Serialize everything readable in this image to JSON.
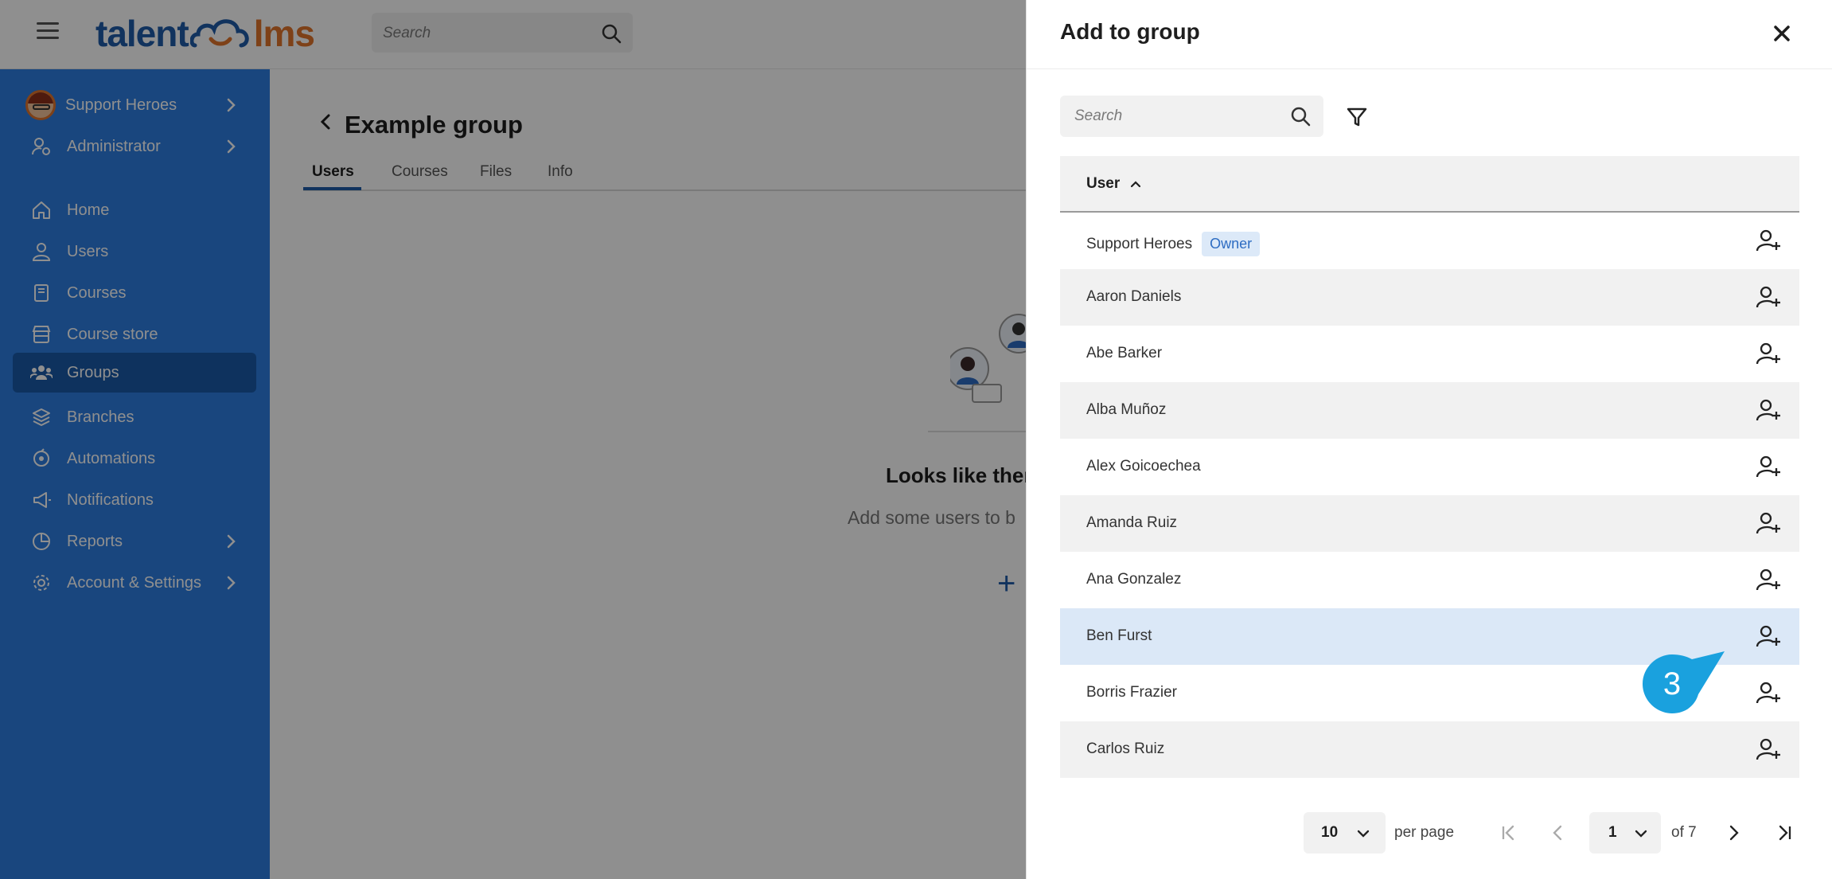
{
  "topbar": {
    "logo_left": "talent",
    "logo_right": "lms",
    "search_placeholder": "Search"
  },
  "sidebar": {
    "items": [
      {
        "label": "Support Heroes",
        "icon": "user-avatar"
      },
      {
        "label": "Administrator",
        "icon": "user-gear-icon"
      },
      {
        "label": "Home",
        "icon": "home-icon"
      },
      {
        "label": "Users",
        "icon": "user-icon"
      },
      {
        "label": "Courses",
        "icon": "book-icon"
      },
      {
        "label": "Course store",
        "icon": "store-icon"
      },
      {
        "label": "Groups",
        "icon": "users-group-icon"
      },
      {
        "label": "Branches",
        "icon": "layers-icon"
      },
      {
        "label": "Automations",
        "icon": "automation-icon"
      },
      {
        "label": "Notifications",
        "icon": "megaphone-icon"
      },
      {
        "label": "Reports",
        "icon": "pie-chart-icon"
      },
      {
        "label": "Account & Settings",
        "icon": "gear-icon"
      }
    ]
  },
  "main": {
    "title": "Example group",
    "tabs": [
      "Users",
      "Courses",
      "Files",
      "Info"
    ],
    "empty_title": "Looks like ther",
    "empty_subtitle": "Add some users to b"
  },
  "drawer": {
    "title": "Add to group",
    "search_placeholder": "Search",
    "column_header": "User",
    "rows": [
      {
        "name": "Support Heroes",
        "badge": "Owner"
      },
      {
        "name": "Aaron Daniels"
      },
      {
        "name": "Abe Barker"
      },
      {
        "name": "Alba Muñoz"
      },
      {
        "name": "Alex Goicoechea"
      },
      {
        "name": "Amanda Ruiz"
      },
      {
        "name": "Ana Gonzalez"
      },
      {
        "name": "Ben Furst"
      },
      {
        "name": "Borris Frazier"
      },
      {
        "name": "Carlos Ruiz"
      }
    ],
    "callout_step": "3",
    "pagination": {
      "per_page_value": "10",
      "per_page_label": "per page",
      "current_page": "1",
      "of_pages": "of 7"
    }
  },
  "colors": {
    "sidebar_bg": "#2d7de0",
    "sidebar_active": "#1a5aa8",
    "accent_blue": "#1f5ba8",
    "logo_orange": "#e0742c",
    "callout": "#1aa1de",
    "row_highlight": "#dbe8f7"
  }
}
